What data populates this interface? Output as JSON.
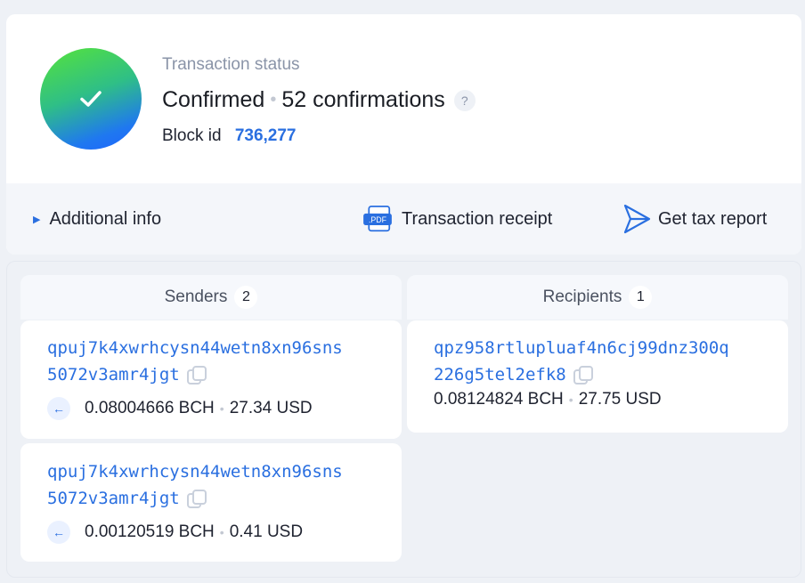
{
  "status": {
    "label": "Transaction status",
    "state": "Confirmed",
    "confirmations": "52 confirmations",
    "help": "?",
    "block_label": "Block id",
    "block_id": "736,277"
  },
  "actions": {
    "additional_info": "Additional info",
    "receipt": "Transaction receipt",
    "receipt_icon_text": ".PDF",
    "tax_report": "Get tax report"
  },
  "senders": {
    "title": "Senders",
    "count": "2",
    "items": [
      {
        "address_line1": "qpuj7k4xwrhcysn44wetn8xn96sns",
        "address_line2": "5072v3amr4jgt",
        "amount": "0.08004666 BCH",
        "usd": "27.34 USD"
      },
      {
        "address_line1": "qpuj7k4xwrhcysn44wetn8xn96sns",
        "address_line2": "5072v3amr4jgt",
        "amount": "0.00120519 BCH",
        "usd": "0.41 USD"
      }
    ]
  },
  "recipients": {
    "title": "Recipients",
    "count": "1",
    "items": [
      {
        "address_line1": "qpz958rtlupluaf4n6cj99dnz300q",
        "address_line2": "226g5tel2efk8",
        "amount": "0.08124824 BCH",
        "usd": "27.75 USD"
      }
    ]
  },
  "icons": {
    "status": "checkmark-icon",
    "expand": "triangle-right-icon",
    "receipt": "pdf-icon",
    "tax": "send-icon",
    "copy": "copy-icon",
    "direction": "arrow-left-icon"
  },
  "colors": {
    "accent": "#2a6fe0",
    "success_gradient_start": "#56e33a",
    "success_gradient_end": "#1e63ff"
  }
}
